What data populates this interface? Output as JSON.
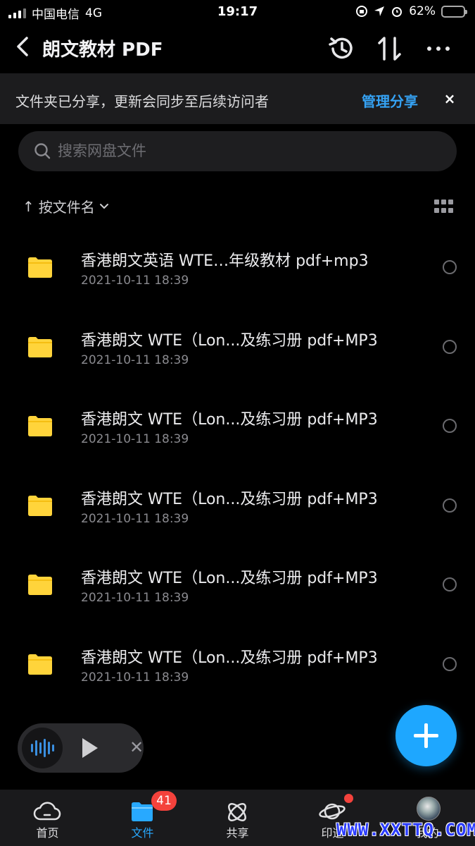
{
  "status_bar": {
    "carrier": "中国电信",
    "network": "4G",
    "time": "19:17",
    "battery": "62%",
    "battery_level": 0.62
  },
  "header": {
    "back_icon": "chevron-left-icon",
    "title": "朗文教材 PDF",
    "actions": [
      "history-icon",
      "sort-arrows-icon",
      "more-icon"
    ]
  },
  "banner": {
    "text": "文件夹已分享，更新会同步至后续访问者",
    "manage_label": "管理分享",
    "close_label": "×"
  },
  "search": {
    "placeholder": "搜索网盘文件"
  },
  "sort": {
    "arrow": "↑",
    "label": "按文件名",
    "view_toggle_icon": "grid-view-icon"
  },
  "files": [
    {
      "name": "香港朗文英语 WTE…年级教材 pdf+mp3",
      "date": "2021-10-11 18:39"
    },
    {
      "name": "香港朗文 WTE（Lon...及练习册 pdf+MP3",
      "date": "2021-10-11 18:39"
    },
    {
      "name": "香港朗文 WTE（Lon...及练习册 pdf+MP3",
      "date": "2021-10-11 18:39"
    },
    {
      "name": "香港朗文 WTE（Lon...及练习册 pdf+MP3",
      "date": "2021-10-11 18:39"
    },
    {
      "name": "香港朗文 WTE（Lon...及练习册 pdf+MP3",
      "date": "2021-10-11 18:39"
    },
    {
      "name": "香港朗文 WTE（Lon...及练习册 pdf+MP3",
      "date": "2021-10-11 18:39"
    }
  ],
  "player": {
    "close_label": "✕"
  },
  "tabs": [
    {
      "label": "首页",
      "icon": "cloud-home-icon"
    },
    {
      "label": "文件",
      "icon": "folder-icon",
      "active": true
    },
    {
      "label": "共享",
      "icon": "share-atom-icon",
      "badge": "41"
    },
    {
      "label": "印逆",
      "icon": "planet-icon",
      "dot": true
    },
    {
      "label": "我的",
      "icon": "avatar"
    }
  ],
  "watermark": "WWW.XXTTQ.COM",
  "colors": {
    "accent": "#1ea7ff",
    "link": "#35a2f4",
    "folder": "#ffd43b",
    "badge": "#f4423c",
    "background": "#000000"
  }
}
